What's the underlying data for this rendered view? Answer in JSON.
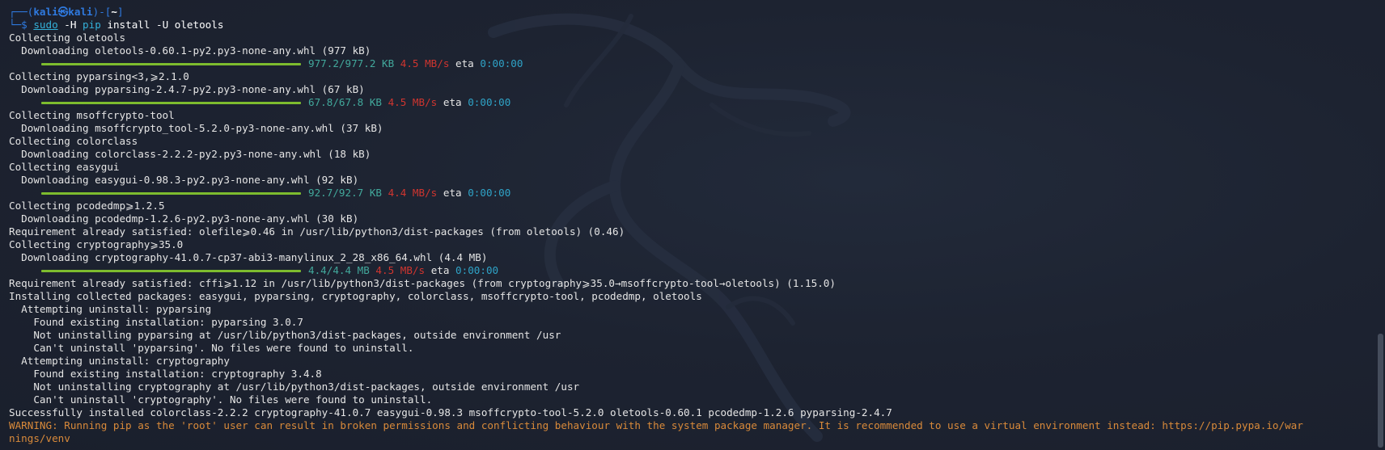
{
  "prompt": {
    "top_left": "┌──(",
    "user": "kali",
    "at": "㉿",
    "host": "kali",
    "mid": ")-[",
    "cwd": "~",
    "end": "]",
    "bottom_left": "└─",
    "dollar": "$ ",
    "cmd_sudo": "sudo",
    "cmd_flag": " -H ",
    "cmd_pip": "pip",
    "cmd_args": " install -U oletools"
  },
  "lines": {
    "l3": "Collecting oletools",
    "l4": "  Downloading oletools-0.60.1-py2.py3-none-any.whl (977 kB)",
    "l6": "Collecting pyparsing<3,⩾2.1.0",
    "l7": "  Downloading pyparsing-2.4.7-py2.py3-none-any.whl (67 kB)",
    "l9": "Collecting msoffcrypto-tool",
    "l10": "  Downloading msoffcrypto_tool-5.2.0-py3-none-any.whl (37 kB)",
    "l11": "Collecting colorclass",
    "l12": "  Downloading colorclass-2.2.2-py2.py3-none-any.whl (18 kB)",
    "l13": "Collecting easygui",
    "l14": "  Downloading easygui-0.98.3-py2.py3-none-any.whl (92 kB)",
    "l16": "Collecting pcodedmp⩾1.2.5",
    "l17": "  Downloading pcodedmp-1.2.6-py2.py3-none-any.whl (30 kB)",
    "l18": "Requirement already satisfied: olefile⩾0.46 in /usr/lib/python3/dist-packages (from oletools) (0.46)",
    "l19": "Collecting cryptography⩾35.0",
    "l20": "  Downloading cryptography-41.0.7-cp37-abi3-manylinux_2_28_x86_64.whl (4.4 MB)",
    "l22": "Requirement already satisfied: cffi⩾1.12 in /usr/lib/python3/dist-packages (from cryptography⩾35.0→msoffcrypto-tool→oletools) (1.15.0)",
    "l23": "Installing collected packages: easygui, pyparsing, cryptography, colorclass, msoffcrypto-tool, pcodedmp, oletools",
    "l24": "  Attempting uninstall: pyparsing",
    "l25": "    Found existing installation: pyparsing 3.0.7",
    "l26": "    Not uninstalling pyparsing at /usr/lib/python3/dist-packages, outside environment /usr",
    "l27": "    Can't uninstall 'pyparsing'. No files were found to uninstall.",
    "l28": "  Attempting uninstall: cryptography",
    "l29": "    Found existing installation: cryptography 3.4.8",
    "l30": "    Not uninstalling cryptography at /usr/lib/python3/dist-packages, outside environment /usr",
    "l31": "    Can't uninstall 'cryptography'. No files were found to uninstall.",
    "l32": "Successfully installed colorclass-2.2.2 cryptography-41.0.7 easygui-0.98.3 msoffcrypto-tool-5.2.0 oletools-0.60.1 pcodedmp-1.2.6 pyparsing-2.4.7",
    "l33": "WARNING: Running pip as the 'root' user can result in broken permissions and conflicting behaviour with the system package manager. It is recommended to use a virtual environment instead: https://pip.pypa.io/war",
    "l34": "nings/venv"
  },
  "progress": [
    {
      "fraction": 1.0,
      "size": "977.2/977.2 KB",
      "speed": "4.5 MB/s",
      "eta_label": "eta",
      "eta": "0:00:00"
    },
    {
      "fraction": 1.0,
      "size": "67.8/67.8 KB",
      "speed": "4.5 MB/s",
      "eta_label": "eta",
      "eta": "0:00:00"
    },
    {
      "fraction": 1.0,
      "size": "92.7/92.7 KB",
      "speed": "4.4 MB/s",
      "eta_label": "eta",
      "eta": "0:00:00"
    },
    {
      "fraction": 1.0,
      "size": "4.4/4.4 MB",
      "speed": "4.5 MB/s",
      "eta_label": "eta",
      "eta": "0:00:00"
    }
  ],
  "colors": {
    "background": "#1c2230",
    "prompt_blue": "#2f7ae0",
    "command_cyan": "#34b1d9",
    "progress_green": "#7dbc2e",
    "size_teal": "#42a89b",
    "speed_red": "#d0352f",
    "eta_blue": "#2fa3c7",
    "warning_orange": "#d98a3a"
  },
  "icons": {
    "background": "kali-dragon-watermark",
    "scrollbar": "scrollbar-thumb"
  }
}
